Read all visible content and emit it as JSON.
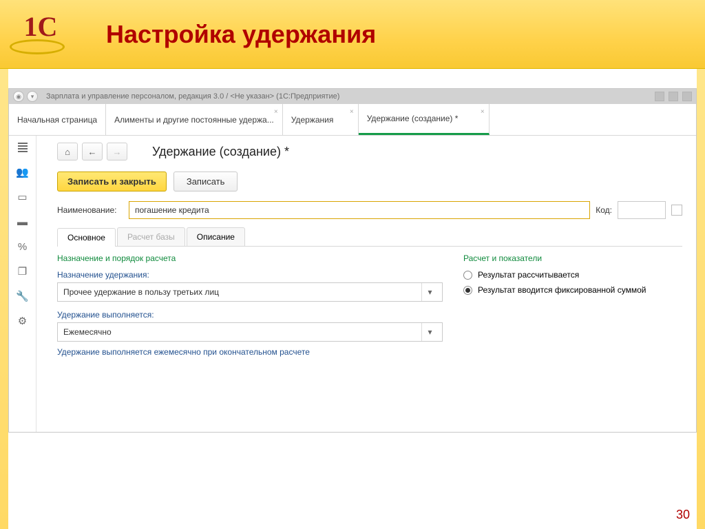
{
  "slide": {
    "title": "Настройка удержания",
    "number": "30",
    "logo_text": "1С"
  },
  "window": {
    "title": "Зарплата и управление персоналом, редакция 3.0 / <Не указан>  (1С:Предприятие)"
  },
  "tabs": [
    {
      "label": "Начальная страница",
      "closable": false
    },
    {
      "label": "Алименты и другие постоянные удержа...",
      "closable": true
    },
    {
      "label": "Удержания",
      "closable": true
    },
    {
      "label": "Удержание (создание) *",
      "closable": true,
      "active": true
    }
  ],
  "page": {
    "heading": "Удержание (создание) *"
  },
  "actions": {
    "save_close": "Записать и закрыть",
    "save": "Записать"
  },
  "fields": {
    "name_label": "Наименование:",
    "name_value": "погашение кредита",
    "code_label": "Код:",
    "code_value": ""
  },
  "subtabs": {
    "main": "Основное",
    "base": "Расчет базы",
    "descr": "Описание"
  },
  "sections": {
    "left_title": "Назначение и порядок расчета",
    "right_title": "Расчет и показатели"
  },
  "purpose": {
    "label": "Назначение удержания:",
    "value": "Прочее удержание в пользу третьих лиц"
  },
  "schedule": {
    "label": "Удержание выполняется:",
    "value": "Ежемесячно",
    "hint": "Удержание выполняется ежемесячно при окончательном расчете"
  },
  "calc": {
    "opt1": "Результат рассчитывается",
    "opt2": "Результат вводится фиксированной суммой",
    "selected": 2
  },
  "side_icons": [
    "menu",
    "people",
    "card",
    "card2",
    "percent",
    "docs",
    "wrench",
    "gear"
  ]
}
